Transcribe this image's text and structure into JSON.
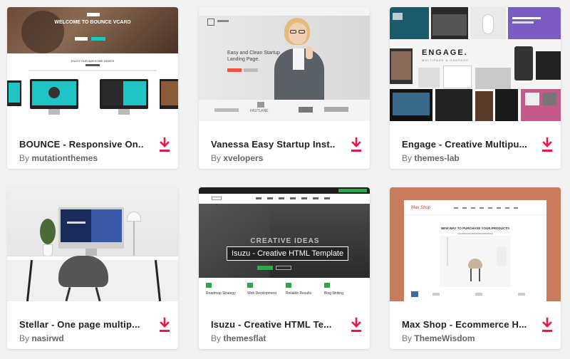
{
  "colors": {
    "accent": "#e8194a",
    "page_bg": "#f2f2f2",
    "card_bg": "#ffffff"
  },
  "cards": [
    {
      "title": "BOUNCE - Responsive On...",
      "by_prefix": "By",
      "author": "mutationthemes",
      "thumb": {
        "hero_title": "WELCOME TO BOUNCE VCARD",
        "section_title": "ENJOY OUR AWESOME DEMOS"
      }
    },
    {
      "title": "Vanessa Easy Startup Inst...",
      "by_prefix": "By",
      "author": "xvelopers",
      "thumb": {
        "headline": "Easy and Clean Startup Landing Page.",
        "logo_2": "FASTLANE"
      }
    },
    {
      "title": "Engage - Creative Multipu...",
      "by_prefix": "By",
      "author": "themes-lab",
      "thumb": {
        "brand": "ENGAGE.",
        "tagline": "MULTIPAGE & ONEPAGE"
      }
    },
    {
      "title": "Stellar - One page multip...",
      "by_prefix": "By",
      "author": "nasirwd",
      "thumb": {}
    },
    {
      "title": "Isuzu - Creative HTML Te...",
      "by_prefix": "By",
      "author": "themesflat",
      "thumb": {
        "hero_text": "CREATIVE IDEAS",
        "tooltip": "Isuzu - Creative HTML Template",
        "services": [
          "Roadmap Strategy",
          "Web Development",
          "Reliable Results",
          "Blog Writing"
        ]
      }
    },
    {
      "title": "Max Shop - Ecommerce H...",
      "by_prefix": "By",
      "author": "ThemeWisdom",
      "thumb": {
        "logo": "Max Shop",
        "headline": "NEW WAY TO PURCHASE YOUR PRODUCTS"
      }
    }
  ],
  "icons": {
    "download": "download-icon"
  }
}
